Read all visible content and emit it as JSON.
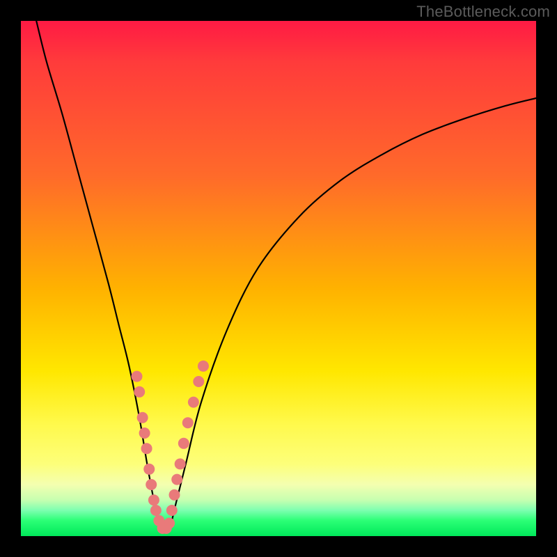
{
  "attribution": "TheBottleneck.com",
  "colors": {
    "frame": "#000000",
    "curve": "#000000",
    "marker_fill": "#e97a7a",
    "marker_stroke": "#d85a5a",
    "gradient_top": "#ff1a44",
    "gradient_bottom": "#00e85a"
  },
  "chart_data": {
    "type": "line",
    "title": "",
    "xlabel": "",
    "ylabel": "",
    "xlim": [
      0,
      100
    ],
    "ylim": [
      0,
      100
    ],
    "grid": false,
    "legend": false,
    "series": [
      {
        "name": "bottleneck-curve",
        "x": [
          3,
          5,
          8,
          11,
          14,
          17,
          19,
          21,
          23,
          24.5,
          26,
          27,
          28,
          29,
          30,
          32,
          35,
          40,
          46,
          54,
          62,
          70,
          78,
          86,
          94,
          100
        ],
        "y": [
          100,
          92,
          82,
          71,
          60,
          49,
          41,
          33,
          23,
          14,
          6,
          2,
          1,
          2,
          6,
          14,
          26,
          40,
          52,
          62,
          69,
          74,
          78,
          81,
          83.5,
          85
        ]
      }
    ],
    "markers": [
      {
        "x": 22.5,
        "y": 31
      },
      {
        "x": 23.0,
        "y": 28
      },
      {
        "x": 23.6,
        "y": 23
      },
      {
        "x": 24.0,
        "y": 20
      },
      {
        "x": 24.4,
        "y": 17
      },
      {
        "x": 24.9,
        "y": 13
      },
      {
        "x": 25.3,
        "y": 10
      },
      {
        "x": 25.8,
        "y": 7
      },
      {
        "x": 26.2,
        "y": 5
      },
      {
        "x": 26.8,
        "y": 3
      },
      {
        "x": 27.5,
        "y": 1.5
      },
      {
        "x": 28.2,
        "y": 1.5
      },
      {
        "x": 28.8,
        "y": 2.5
      },
      {
        "x": 29.3,
        "y": 5
      },
      {
        "x": 29.8,
        "y": 8
      },
      {
        "x": 30.3,
        "y": 11
      },
      {
        "x": 30.9,
        "y": 14
      },
      {
        "x": 31.6,
        "y": 18
      },
      {
        "x": 32.4,
        "y": 22
      },
      {
        "x": 33.5,
        "y": 26
      },
      {
        "x": 34.5,
        "y": 30
      },
      {
        "x": 35.4,
        "y": 33
      }
    ],
    "marker_radius_px": 8
  }
}
